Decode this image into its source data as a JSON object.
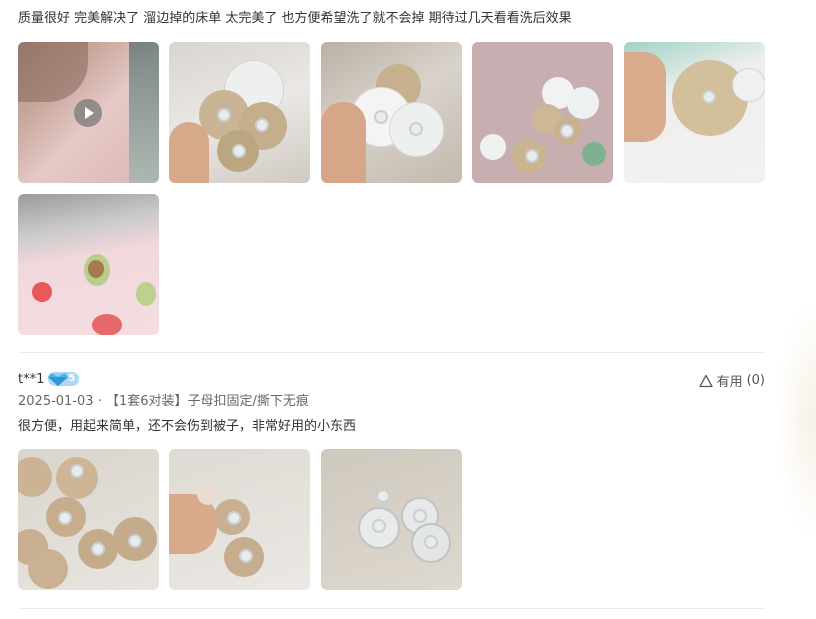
{
  "review1": {
    "text": "质量很好 完美解决了 溜边掉的床单 太完美了 也方便希望洗了就不会掉 期待过几天看看洗后效果",
    "media": [
      {
        "type": "video",
        "icon": "play-icon"
      },
      {
        "type": "image"
      },
      {
        "type": "image"
      },
      {
        "type": "image"
      },
      {
        "type": "image"
      },
      {
        "type": "image"
      }
    ]
  },
  "review2": {
    "username": "t**1",
    "vip_level": "5",
    "badge_icon": "diamond-icon",
    "date": "2025-01-03",
    "separator": "·",
    "variant": "【1套6对装】子母扣固定/撕下无痕",
    "text": "很方便，用起来简单，还不会伤到被子，非常好用的小东西",
    "useful_label": "有用",
    "useful_count": "(0)",
    "useful_icon": "thumbs-up-outline-icon",
    "media": [
      {
        "type": "image"
      },
      {
        "type": "image"
      },
      {
        "type": "image"
      }
    ]
  },
  "colors": {
    "text": "#333333",
    "meta": "#666666",
    "divider": "#ececec",
    "badge": "#a9d9f5"
  }
}
